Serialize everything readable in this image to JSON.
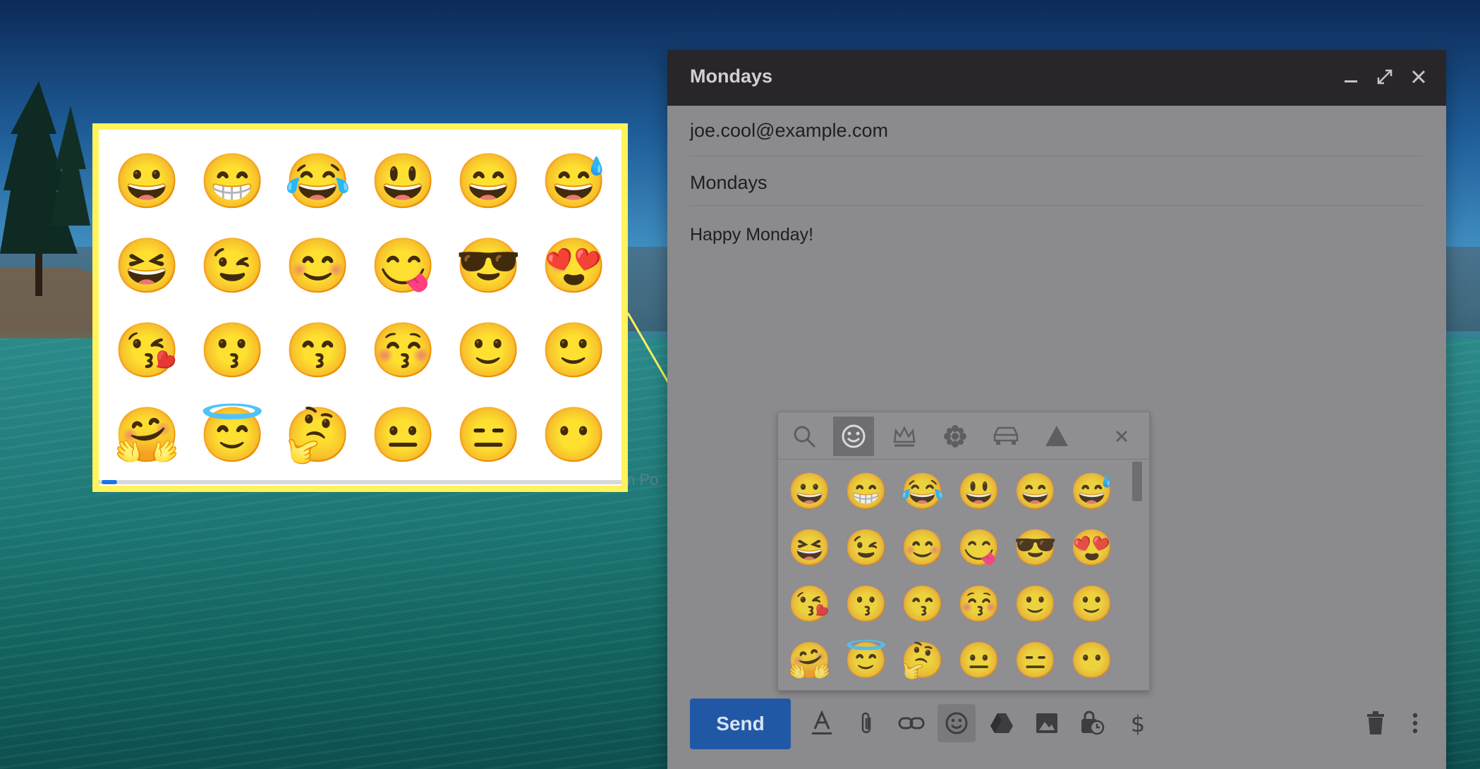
{
  "callout": {
    "emojis": [
      "😀",
      "😁",
      "😂",
      "😃",
      "😄",
      "😅",
      "😆",
      "😉",
      "😊",
      "😋",
      "😎",
      "😍",
      "😘",
      "😗",
      "😙",
      "😚",
      "🙂",
      "🙂",
      "🤗",
      "😇",
      "🤔",
      "😐",
      "😑",
      "😶"
    ]
  },
  "background_text": "m Po",
  "compose": {
    "title": "Mondays",
    "to": "joe.cool@example.com",
    "subject": "Mondays",
    "body": "Happy Monday!",
    "send_label": "Send",
    "picker": {
      "emojis": [
        "😀",
        "😁",
        "😂",
        "😃",
        "😄",
        "😅",
        "😆",
        "😉",
        "😊",
        "😋",
        "😎",
        "😍",
        "😘",
        "😗",
        "😙",
        "😚",
        "🙂",
        "🙂",
        "🤗",
        "😇",
        "🤔",
        "😐",
        "😑",
        "😶"
      ]
    }
  },
  "colors": {
    "highlight": "#fff35c",
    "send_button": "#2158a6",
    "titlebar": "#282629"
  }
}
